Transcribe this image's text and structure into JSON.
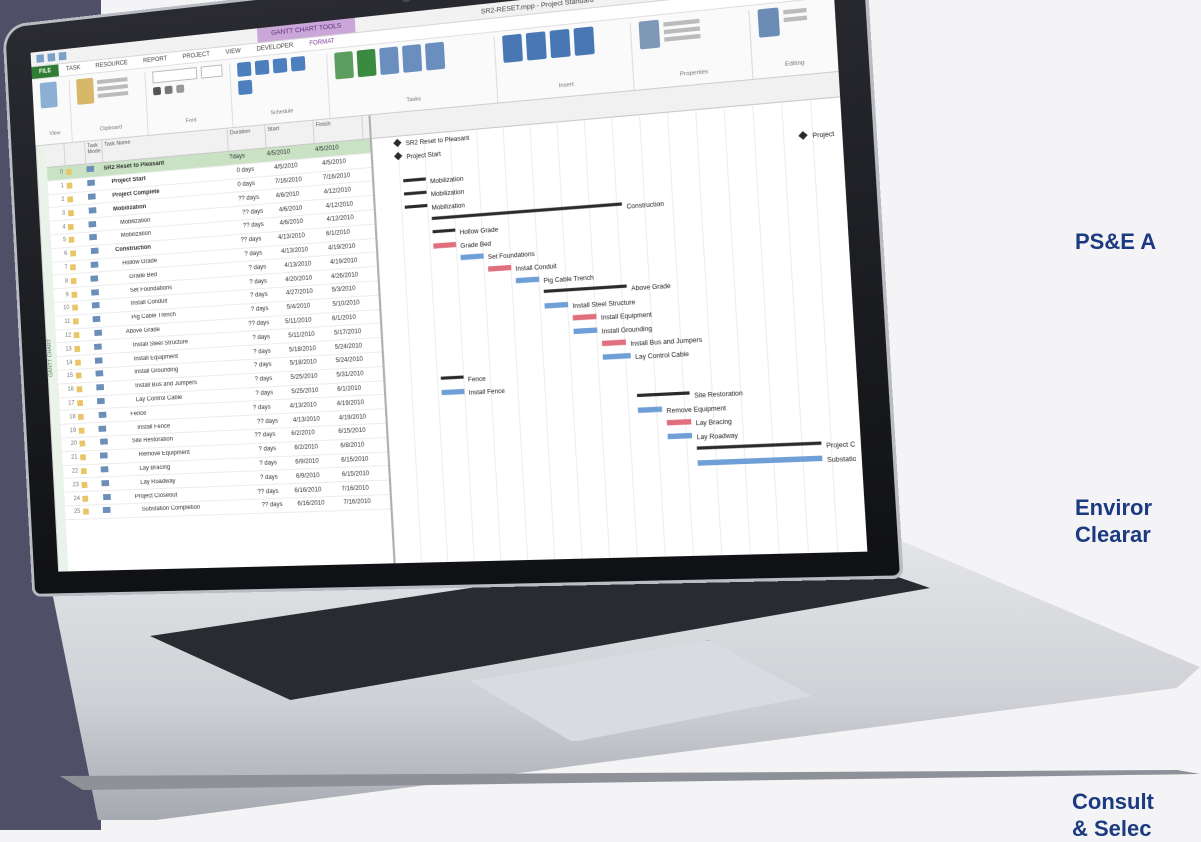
{
  "side_labels": [
    "PS&E A",
    "Enviror",
    "Clearar",
    "Consult",
    "& Selec"
  ],
  "project_window": {
    "title": "SR2-RESET.mpp - Project Standard",
    "context_tab": "GANTT CHART TOOLS",
    "tabs": [
      "FILE",
      "TASK",
      "RESOURCE",
      "REPORT",
      "PROJECT",
      "VIEW",
      "DEVELOPER",
      "FORMAT"
    ],
    "ribbon_groups": [
      "View",
      "Clipboard",
      "Font",
      "Schedule",
      "Tasks",
      "Insert",
      "Properties",
      "Editing"
    ],
    "timeline_label": "GANTT CHART",
    "columns": [
      "Task Mode",
      "Task Name",
      "Duration",
      "Start",
      "Finish"
    ]
  },
  "tasks": [
    {
      "id": "0",
      "name": "SR2 Reset to Pleasant",
      "dur": "?days",
      "start": "4/5/2010",
      "finish": "4/5/2010",
      "level": 0
    },
    {
      "id": "1",
      "name": "Project Start",
      "dur": "0 days",
      "start": "4/5/2010",
      "finish": "4/5/2010",
      "level": 1
    },
    {
      "id": "2",
      "name": "Project Complete",
      "dur": "0 days",
      "start": "7/16/2010",
      "finish": "7/16/2010",
      "level": 1
    },
    {
      "id": "3",
      "name": "Mobilization",
      "dur": "?? days",
      "start": "4/6/2010",
      "finish": "4/12/2010",
      "level": 1
    },
    {
      "id": "4",
      "name": "Mobilization",
      "dur": "?? days",
      "start": "4/6/2010",
      "finish": "4/12/2010",
      "level": 2
    },
    {
      "id": "5",
      "name": "Mobilization",
      "dur": "?? days",
      "start": "4/6/2010",
      "finish": "4/12/2010",
      "level": 2
    },
    {
      "id": "6",
      "name": "Construction",
      "dur": "?? days",
      "start": "4/13/2010",
      "finish": "6/1/2010",
      "level": 1
    },
    {
      "id": "7",
      "name": "Hollow Grade",
      "dur": "? days",
      "start": "4/13/2010",
      "finish": "4/19/2010",
      "level": 2
    },
    {
      "id": "8",
      "name": "Grade Bed",
      "dur": "? days",
      "start": "4/13/2010",
      "finish": "4/19/2010",
      "level": 3
    },
    {
      "id": "9",
      "name": "Set Foundations",
      "dur": "? days",
      "start": "4/20/2010",
      "finish": "4/26/2010",
      "level": 3
    },
    {
      "id": "10",
      "name": "Install Conduit",
      "dur": "? days",
      "start": "4/27/2010",
      "finish": "5/3/2010",
      "level": 3
    },
    {
      "id": "11",
      "name": "Pig Cable Trench",
      "dur": "? days",
      "start": "5/4/2010",
      "finish": "5/10/2010",
      "level": 3
    },
    {
      "id": "12",
      "name": "Above Grade",
      "dur": "?? days",
      "start": "5/11/2010",
      "finish": "6/1/2010",
      "level": 2
    },
    {
      "id": "13",
      "name": "Install Steel Structure",
      "dur": "? days",
      "start": "5/11/2010",
      "finish": "5/17/2010",
      "level": 3
    },
    {
      "id": "14",
      "name": "Install Equipment",
      "dur": "? days",
      "start": "5/18/2010",
      "finish": "5/24/2010",
      "level": 3
    },
    {
      "id": "15",
      "name": "Install Grounding",
      "dur": "? days",
      "start": "5/18/2010",
      "finish": "5/24/2010",
      "level": 3
    },
    {
      "id": "16",
      "name": "Install Bus and Jumpers",
      "dur": "? days",
      "start": "5/25/2010",
      "finish": "5/31/2010",
      "level": 3
    },
    {
      "id": "17",
      "name": "Lay Control Cable",
      "dur": "? days",
      "start": "5/25/2010",
      "finish": "6/1/2010",
      "level": 3
    },
    {
      "id": "18",
      "name": "Fence",
      "dur": "? days",
      "start": "4/13/2010",
      "finish": "4/19/2010",
      "level": 2
    },
    {
      "id": "19",
      "name": "Install Fence",
      "dur": "?? days",
      "start": "4/13/2010",
      "finish": "4/19/2010",
      "level": 3
    },
    {
      "id": "20",
      "name": "Site Restoration",
      "dur": "?? days",
      "start": "6/2/2010",
      "finish": "6/15/2010",
      "level": 2
    },
    {
      "id": "21",
      "name": "Remove Equipment",
      "dur": "? days",
      "start": "6/2/2010",
      "finish": "6/8/2010",
      "level": 3
    },
    {
      "id": "22",
      "name": "Lay Bracing",
      "dur": "? days",
      "start": "6/9/2010",
      "finish": "6/15/2010",
      "level": 3
    },
    {
      "id": "23",
      "name": "Lay Roadway",
      "dur": "? days",
      "start": "6/9/2010",
      "finish": "6/15/2010",
      "level": 3
    },
    {
      "id": "24",
      "name": "Project Closeout",
      "dur": "?? days",
      "start": "6/16/2010",
      "finish": "7/16/2010",
      "level": 2
    },
    {
      "id": "25",
      "name": "Substation Completion",
      "dur": "?? days",
      "start": "6/16/2010",
      "finish": "7/16/2010",
      "level": 3
    }
  ],
  "gantt_labels": [
    "SR2 Reset to Pleasant",
    "Project Start",
    "Project Complete",
    "Mobilization",
    "Mobilization",
    "Construction",
    "Hollow Grade",
    "Grade Bed",
    "Set Foundations",
    "Install Conduit",
    "Pig Cable Trench",
    "Above Grade",
    "Install Steel Structure",
    "Install Equipment",
    "Install Grounding",
    "Install Bus and Jumpers",
    "Lay Control Cable",
    "Fence",
    "Install Fence",
    "Site Restoration",
    "Remove Equipment",
    "Lay Bracing",
    "Lay Roadway",
    "Project Closeout",
    "Substation Completion"
  ],
  "colors": {
    "sidebar": "#4f5068",
    "label": "#1b3a80",
    "bar_red": "#e0707d",
    "bar_blue": "#6e9fd6",
    "bar_summary": "#2b2b2b",
    "selected_row": "#c9e2c4"
  }
}
